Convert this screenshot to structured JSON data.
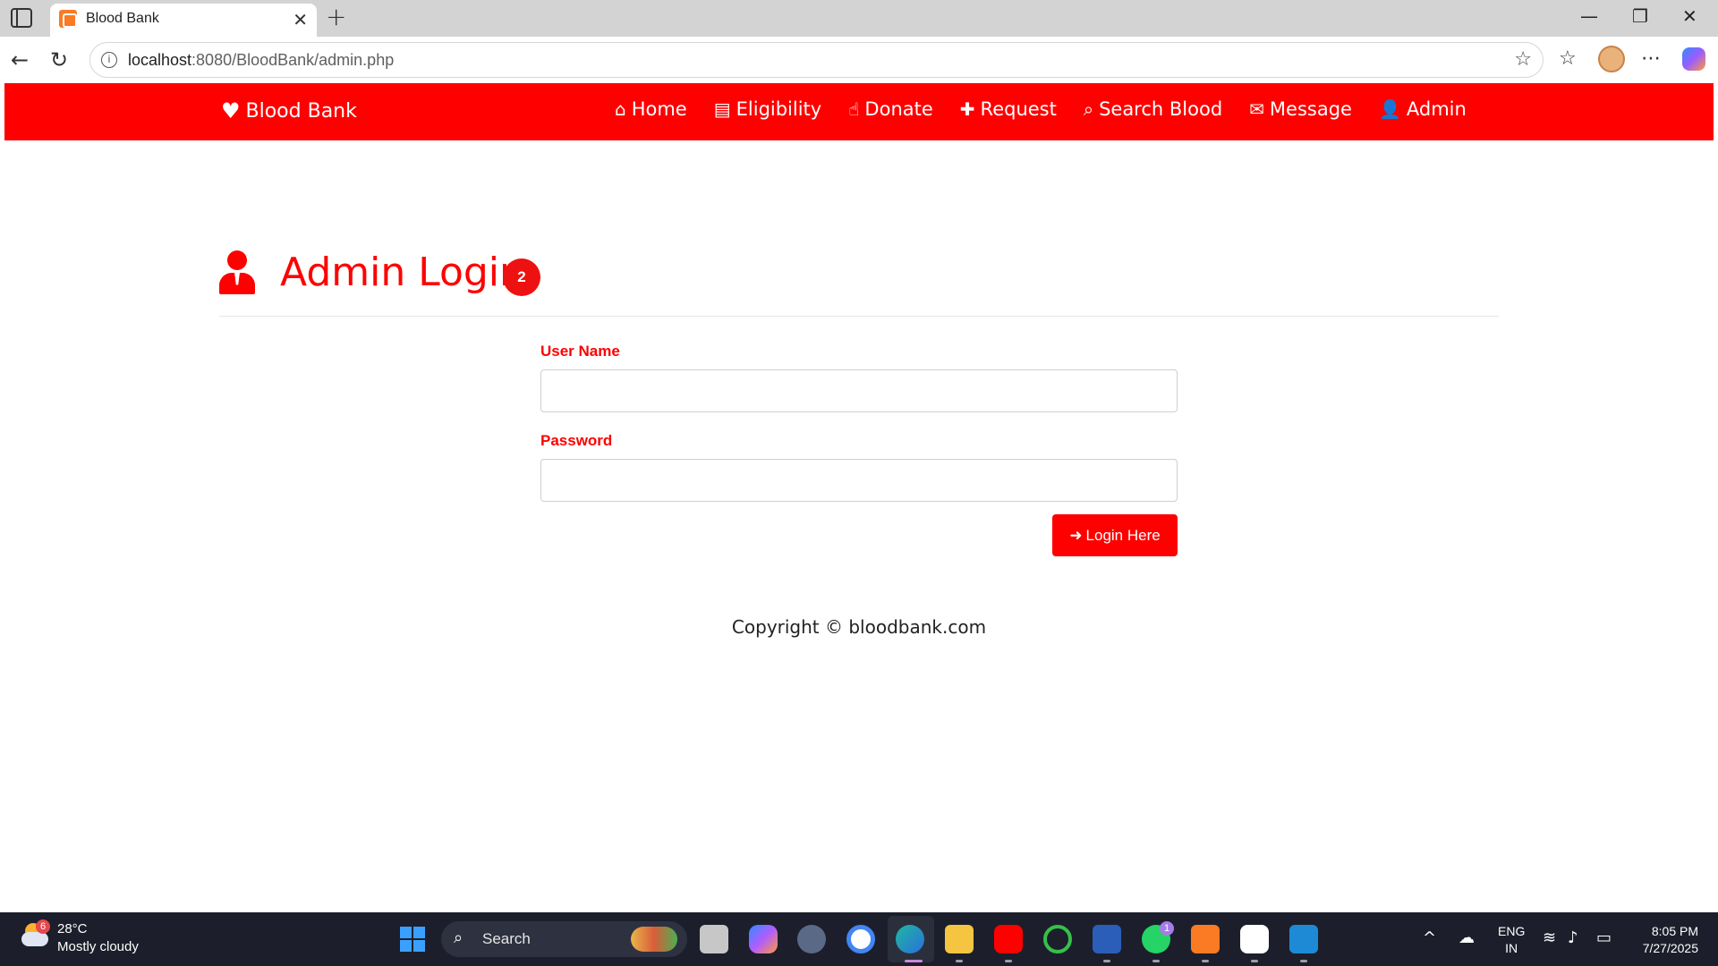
{
  "browser": {
    "tab_title": "Blood Bank",
    "url_host": "localhost",
    "url_rest": ":8080/BloodBank/admin.php"
  },
  "navbar": {
    "brand": "Blood Bank",
    "links": [
      {
        "label": "Home",
        "icon": "home-icon"
      },
      {
        "label": "Eligibility",
        "icon": "clipboard-icon"
      },
      {
        "label": "Donate",
        "icon": "hand-holding-icon"
      },
      {
        "label": "Request",
        "icon": "hospital-user-icon"
      },
      {
        "label": "Search Blood",
        "icon": "search-icon"
      },
      {
        "label": "Message",
        "icon": "envelope-icon"
      },
      {
        "label": "Admin",
        "icon": "user-icon"
      }
    ]
  },
  "main": {
    "heading": "Admin Login",
    "badge": "2",
    "username_label": "User Name",
    "username_value": "",
    "password_label": "Password",
    "password_value": "",
    "login_button": "Login Here",
    "copyright": "Copyright © bloodbank.com"
  },
  "taskbar": {
    "weather_badge": "6",
    "temperature": "28°C",
    "condition": "Mostly cloudy",
    "search_placeholder": "Search",
    "whatsapp_badge": "1",
    "lang_line1": "ENG",
    "lang_line2": "IN",
    "time": "8:05 PM",
    "date": "7/27/2025"
  },
  "colors": {
    "brand_red": "#ff0000",
    "taskbar_bg": "#1c1f2b"
  }
}
